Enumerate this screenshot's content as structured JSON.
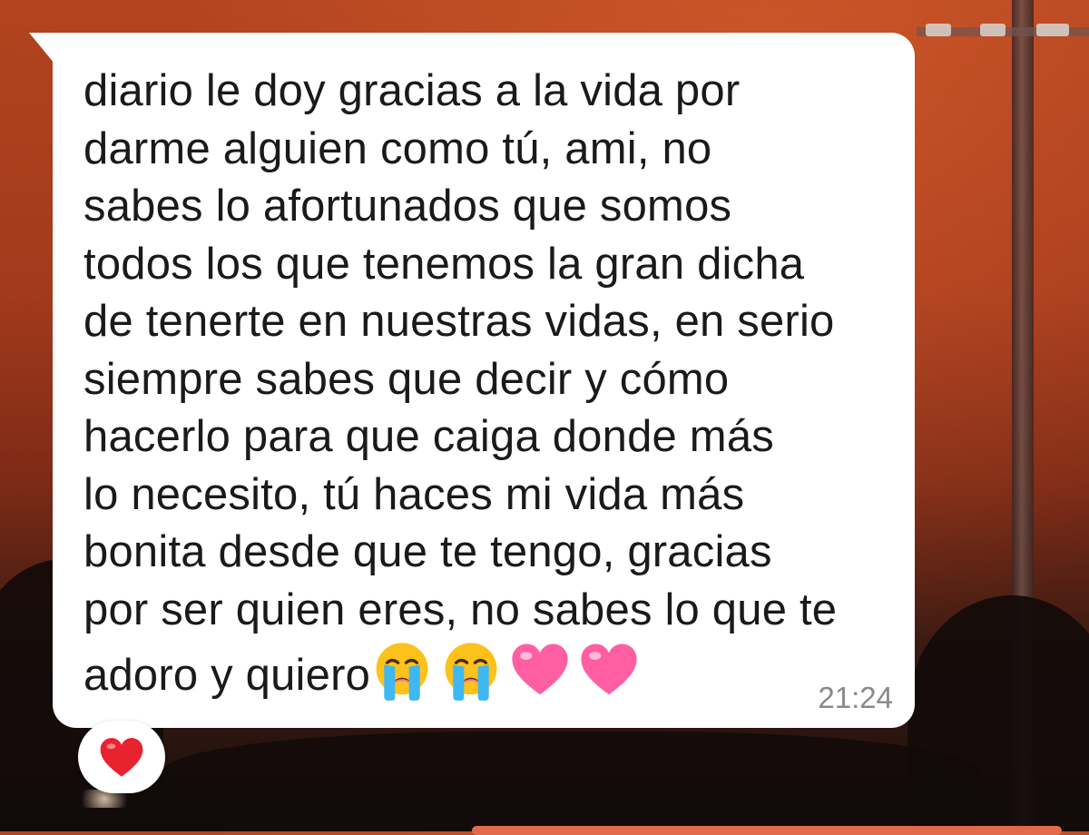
{
  "message": {
    "text": "diario le doy gracias a la vida por\ndarme alguien como tú, ami, no\nsabes lo afortunados que somos\ntodos los que tenemos la gran dicha\nde tenerte en nuestras vidas, en serio\nsiempre sabes que decir y cómo\nhacerlo para que caiga donde más\nlo necesito, tú haces mi vida más\nbonita desde que te tengo, gracias\npor ser quien eres, no sabes lo que te\nadoro y quiero",
    "emojis": [
      "loudly-crying-face",
      "loudly-crying-face",
      "pink-heart",
      "pink-heart"
    ],
    "time": "21:24"
  },
  "reaction": {
    "emoji": "red-heart"
  },
  "colors": {
    "bubble": "#ffffff",
    "text": "#1a1a1a",
    "timestamp": "#8a8a8a",
    "pink_heart": "#ff5fa2",
    "red_heart": "#e8222f",
    "tear": "#3fb7f0",
    "face": "#fcc21b"
  }
}
